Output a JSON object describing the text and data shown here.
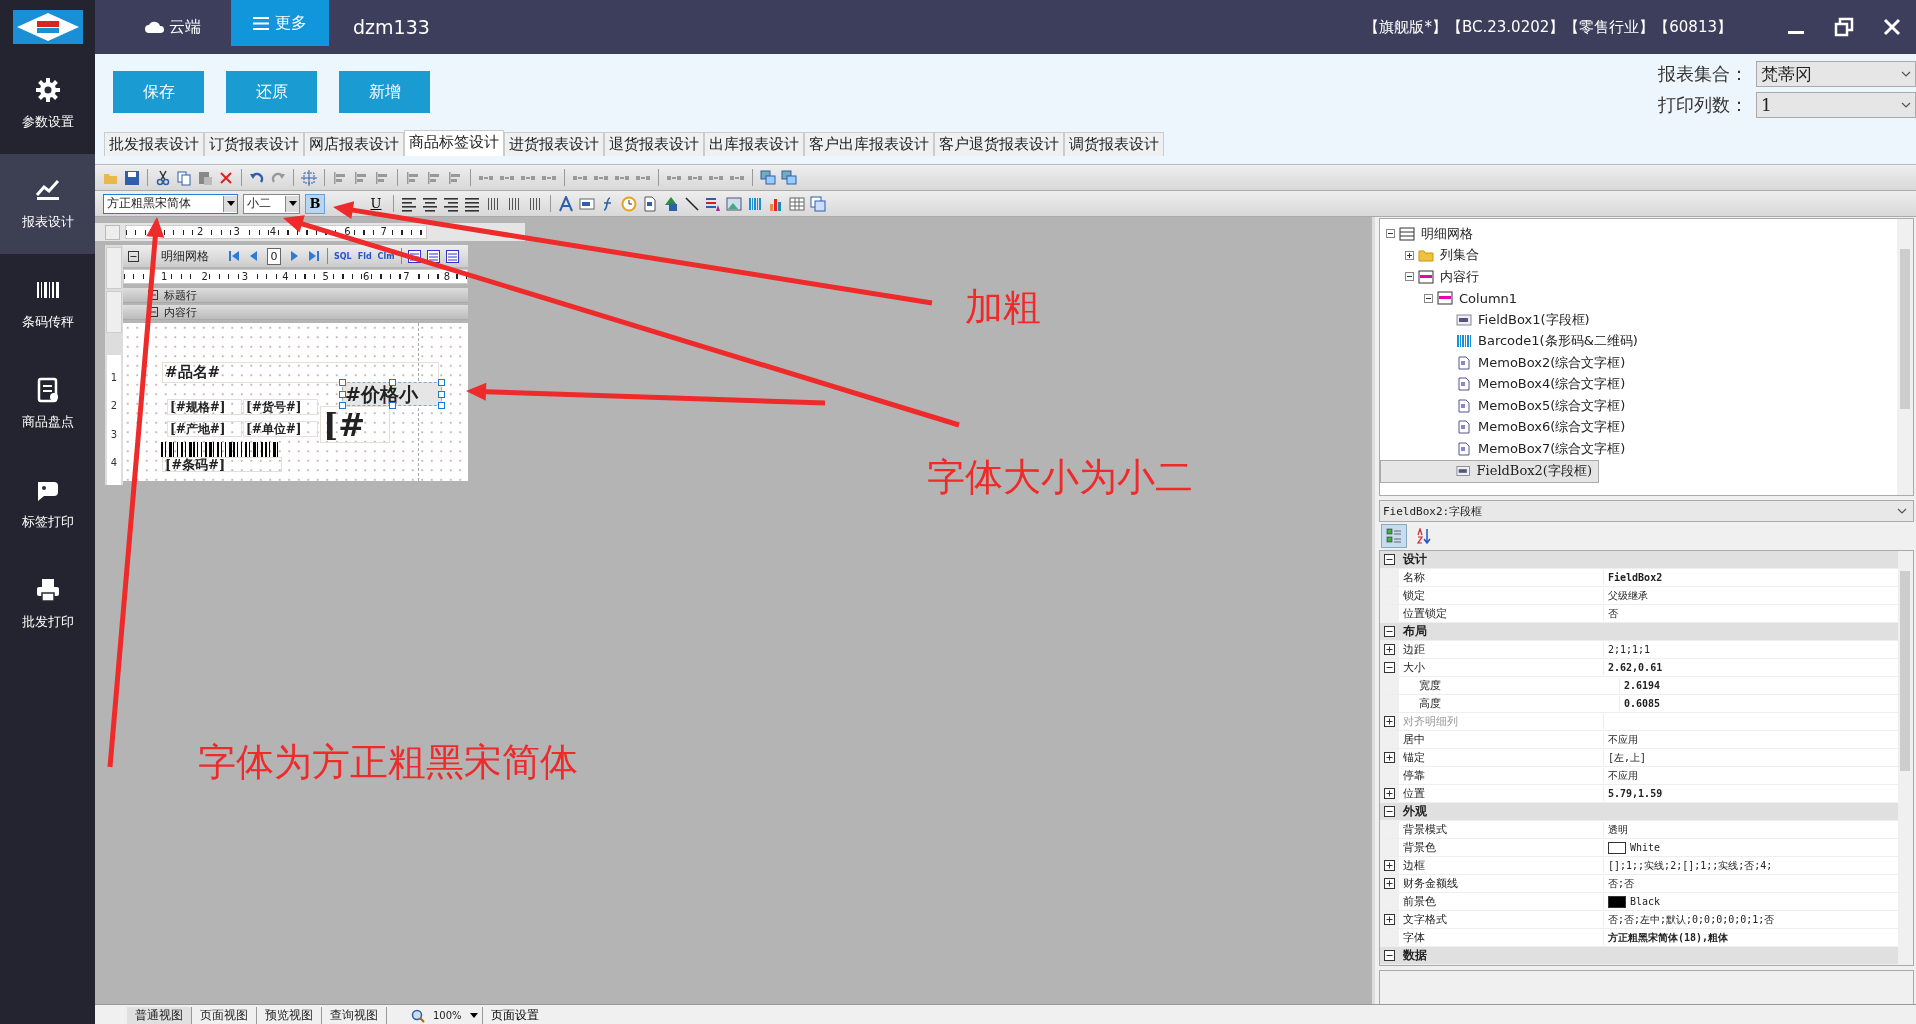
{
  "topbar": {
    "cloud": "云端",
    "more": "更多",
    "user": "dzm133",
    "version": "【旗舰版*】【BC.23.0202】【零售行业】【60813】"
  },
  "sidebar": [
    {
      "label": "参数设置",
      "kind": "gear",
      "selected": false
    },
    {
      "label": "报表设计",
      "kind": "chart",
      "selected": true
    },
    {
      "label": "条码传秤",
      "kind": "barcode",
      "selected": false
    },
    {
      "label": "商品盘点",
      "kind": "clipboard",
      "selected": false
    },
    {
      "label": "标签打印",
      "kind": "tag",
      "selected": false
    },
    {
      "label": "批发打印",
      "kind": "printer",
      "selected": false
    }
  ],
  "actions": [
    "保存",
    "还原",
    "新增"
  ],
  "selects": [
    {
      "label": "报表集合：",
      "value": "梵蒂冈"
    },
    {
      "label": "打印列数：",
      "value": "1"
    }
  ],
  "tabs": [
    {
      "label": "批发报表设计",
      "selected": false
    },
    {
      "label": "订货报表设计",
      "selected": false
    },
    {
      "label": "网店报表设计",
      "selected": false
    },
    {
      "label": "商品标签设计",
      "selected": true
    },
    {
      "label": "进货报表设计",
      "selected": false
    },
    {
      "label": "退货报表设计",
      "selected": false
    },
    {
      "label": "出库报表设计",
      "selected": false
    },
    {
      "label": "客户出库报表设计",
      "selected": false
    },
    {
      "label": "客户退货报表设计",
      "selected": false
    },
    {
      "label": "调货报表设计",
      "selected": false
    }
  ],
  "format_bar": {
    "font": "方正粗黑宋简体",
    "size": "小二",
    "styles": [
      {
        "label": "B",
        "on": true
      },
      {
        "label": "U",
        "on": false
      }
    ]
  },
  "top_ruler": [
    "2",
    "3",
    "4",
    "6",
    "7"
  ],
  "designer": {
    "title": "明细网格",
    "page": "0",
    "tools": [
      "SQL",
      "Fld",
      "Clm"
    ],
    "ruler": [
      "1",
      "2",
      "3",
      "4",
      "5",
      "6",
      "7",
      "8"
    ],
    "side_ruler": [
      "1",
      "2",
      "3",
      "4"
    ],
    "bands": [
      "标题行",
      "内容行"
    ],
    "fields": [
      {
        "text": "#品名#",
        "selected": false
      },
      {
        "text": "[#规格#]",
        "selected": false
      },
      {
        "text": "[#货号#]",
        "selected": false
      },
      {
        "text": "[#产地#]",
        "selected": false
      },
      {
        "text": "[#单位#]",
        "selected": false
      },
      {
        "text": "[#条码#]",
        "selected": false
      },
      {
        "text": "[#",
        "selected": false
      },
      {
        "text": "#价格小",
        "selected": true
      }
    ]
  },
  "tree": [
    {
      "label": "明细网格",
      "kind": "grid",
      "expanded": true,
      "selected": false,
      "children": [
        {
          "label": "列集合",
          "kind": "folder",
          "expanded": false,
          "selected": false
        },
        {
          "label": "内容行",
          "kind": "band",
          "expanded": true,
          "selected": false,
          "children": [
            {
              "label": "Column1",
              "kind": "band",
              "expanded": true,
              "selected": false,
              "children": [
                {
                  "label": "FieldBox1(字段框)",
                  "kind": "field",
                  "selected": false
                },
                {
                  "label": "Barcode1(条形码&二维码)",
                  "kind": "barcode",
                  "selected": false
                },
                {
                  "label": "MemoBox2(综合文字框)",
                  "kind": "memo",
                  "selected": false
                },
                {
                  "label": "MemoBox4(综合文字框)",
                  "kind": "memo",
                  "selected": false
                },
                {
                  "label": "MemoBox5(综合文字框)",
                  "kind": "memo",
                  "selected": false
                },
                {
                  "label": "MemoBox6(综合文字框)",
                  "kind": "memo",
                  "selected": false
                },
                {
                  "label": "MemoBox7(综合文字框)",
                  "kind": "memo",
                  "selected": false
                },
                {
                  "label": "FieldBox2(字段框)",
                  "kind": "field",
                  "selected": true
                }
              ]
            }
          ]
        }
      ]
    }
  ],
  "properties": {
    "selector": "FieldBox2:字段框",
    "views": [
      {
        "kind": "categorized",
        "selected": true
      },
      {
        "kind": "alphabetical",
        "selected": false
      }
    ],
    "groups": [
      {
        "name": "设计",
        "expanded": true,
        "rows": [
          {
            "name": "名称",
            "value": "FieldBox2",
            "bold": true
          },
          {
            "name": "锁定",
            "value": "父级继承"
          },
          {
            "name": "位置锁定",
            "value": "否"
          }
        ]
      },
      {
        "name": "布局",
        "expanded": true,
        "rows": [
          {
            "name": "边距",
            "value": "2;1;1;1",
            "expanded": false
          },
          {
            "name": "大小",
            "value": "2.62,0.61",
            "bold": true,
            "expanded": true,
            "children": [
              {
                "name": "宽度",
                "value": "2.6194",
                "bold": true
              },
              {
                "name": "高度",
                "value": "0.6085",
                "bold": true
              }
            ]
          },
          {
            "name": "对齐明细列",
            "disabled": true,
            "expanded": false
          },
          {
            "name": "居中",
            "value": "不应用"
          },
          {
            "name": "锚定",
            "value": "[左,上]",
            "expanded": false
          },
          {
            "name": "停靠",
            "value": "不应用"
          },
          {
            "name": "位置",
            "value": "5.79,1.59",
            "bold": true,
            "expanded": false
          }
        ]
      },
      {
        "name": "外观",
        "expanded": true,
        "rows": [
          {
            "name": "背景模式",
            "value": "透明"
          },
          {
            "name": "背景色",
            "value": "White",
            "color": "#ffffff"
          },
          {
            "name": "边框",
            "value": "[];1;;实线;2;[];1;;实线;否;4;",
            "expanded": false
          },
          {
            "name": "财务金额线",
            "value": "否;否",
            "expanded": false
          },
          {
            "name": "前景色",
            "value": "Black",
            "color": "#000000"
          },
          {
            "name": "文字格式",
            "value": "否;否;左中;默认;0;0;0;0;0;1;否",
            "expanded": false
          },
          {
            "name": "字体",
            "value": "方正粗黑宋简体(18),粗体",
            "bold": true
          }
        ]
      },
      {
        "name": "数据",
        "expanded": true
      }
    ]
  },
  "view_tabs": [
    {
      "label": "普通视图",
      "selected": true
    },
    {
      "label": "页面视图",
      "selected": false
    },
    {
      "label": "预览视图",
      "selected": false
    },
    {
      "label": "查询视图",
      "selected": false
    }
  ],
  "zoom": "100%",
  "page_setup": "页面设置",
  "annotations": [
    {
      "text": "加粗"
    },
    {
      "text": "字体大小为小二"
    },
    {
      "text": "字体为方正粗黑宋简体"
    }
  ]
}
